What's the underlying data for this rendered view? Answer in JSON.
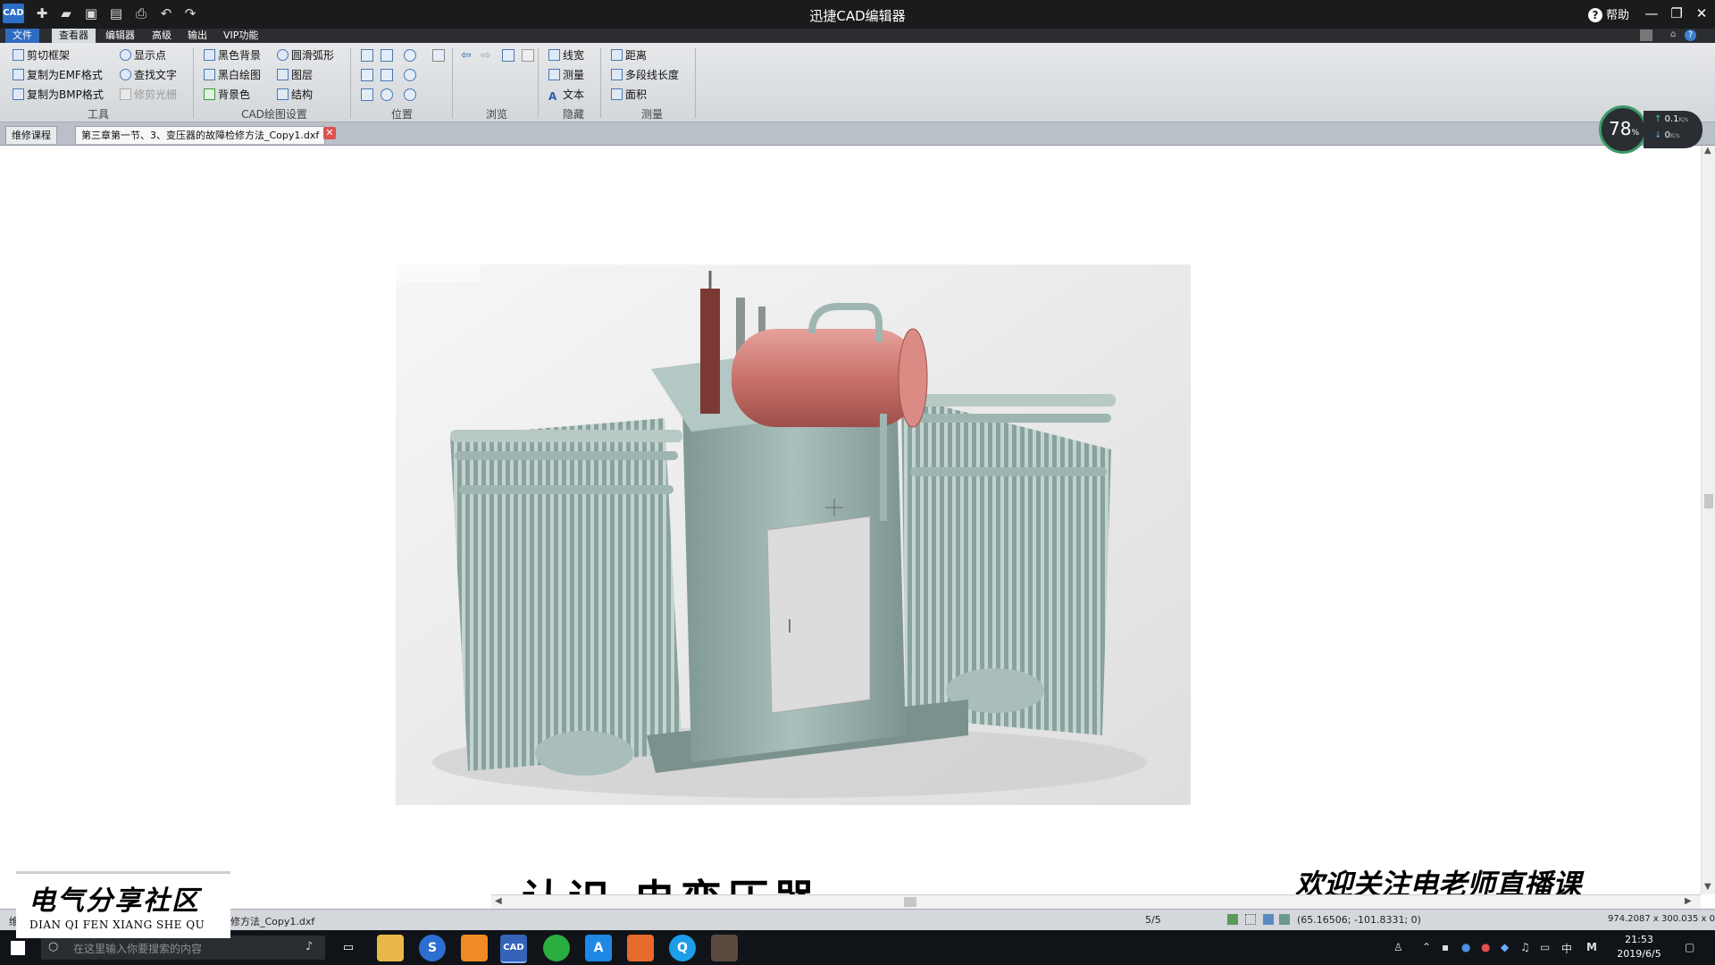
{
  "window": {
    "title": "迅捷CAD编辑器",
    "help_label": "帮助"
  },
  "menu_tabs": [
    "文件",
    "查看器",
    "编辑器",
    "高级",
    "输出",
    "VIP功能"
  ],
  "ribbon": {
    "tools": {
      "items": [
        "剪切框架",
        "复制为EMF格式",
        "复制为BMP格式",
        "显示点",
        "查找文字",
        "修剪光栅"
      ],
      "label": "工具"
    },
    "cad_settings": {
      "items": [
        "黑色背景",
        "黑白绘图",
        "背景色",
        "圆滑弧形",
        "图层",
        "结构"
      ],
      "label": "CAD绘图设置"
    },
    "position": {
      "label": "位置"
    },
    "browse": {
      "label": "浏览"
    },
    "hide": {
      "items": [
        "线宽",
        "测量",
        "文本"
      ],
      "label": "隐藏"
    },
    "measure": {
      "items": [
        "距离",
        "多段线长度",
        "面积"
      ],
      "label": "测量"
    }
  },
  "doc_tabs": [
    "维修课程",
    "第三章第一节、3、变压器的故障检修方法_Copy1.dxf"
  ],
  "speed_widget": {
    "percent": "78",
    "percent_unit": "%",
    "up": "0.1",
    "up_unit": "K/s",
    "down": "0",
    "down_unit": "K/s"
  },
  "canvas": {
    "title_partial": "认识 电变压器",
    "banner": "欢迎关注电老师直播课"
  },
  "watermark": {
    "line1": "电气分享社区",
    "line2": "DIAN QI FEN XIANG SHE QU"
  },
  "statusbar": {
    "left_prefix": "维",
    "filename": "修方法_Copy1.dxf",
    "page": "5/5",
    "coords": "(65.16506; -101.8331; 0)",
    "size": "974.2087 x 300.035 x 0"
  },
  "taskbar": {
    "search_placeholder": "在这里输入你要搜索的内容",
    "clock_time": "21:53",
    "clock_date": "2019/6/5",
    "ime": "中",
    "lang": "M"
  },
  "colors": {
    "title_bg": "#1a1b1d",
    "ribbon_bg": "#dcdfe2",
    "accent": "#2f6bc0",
    "transformer_body": "#8fa9a5",
    "conservator": "#c9726b"
  }
}
